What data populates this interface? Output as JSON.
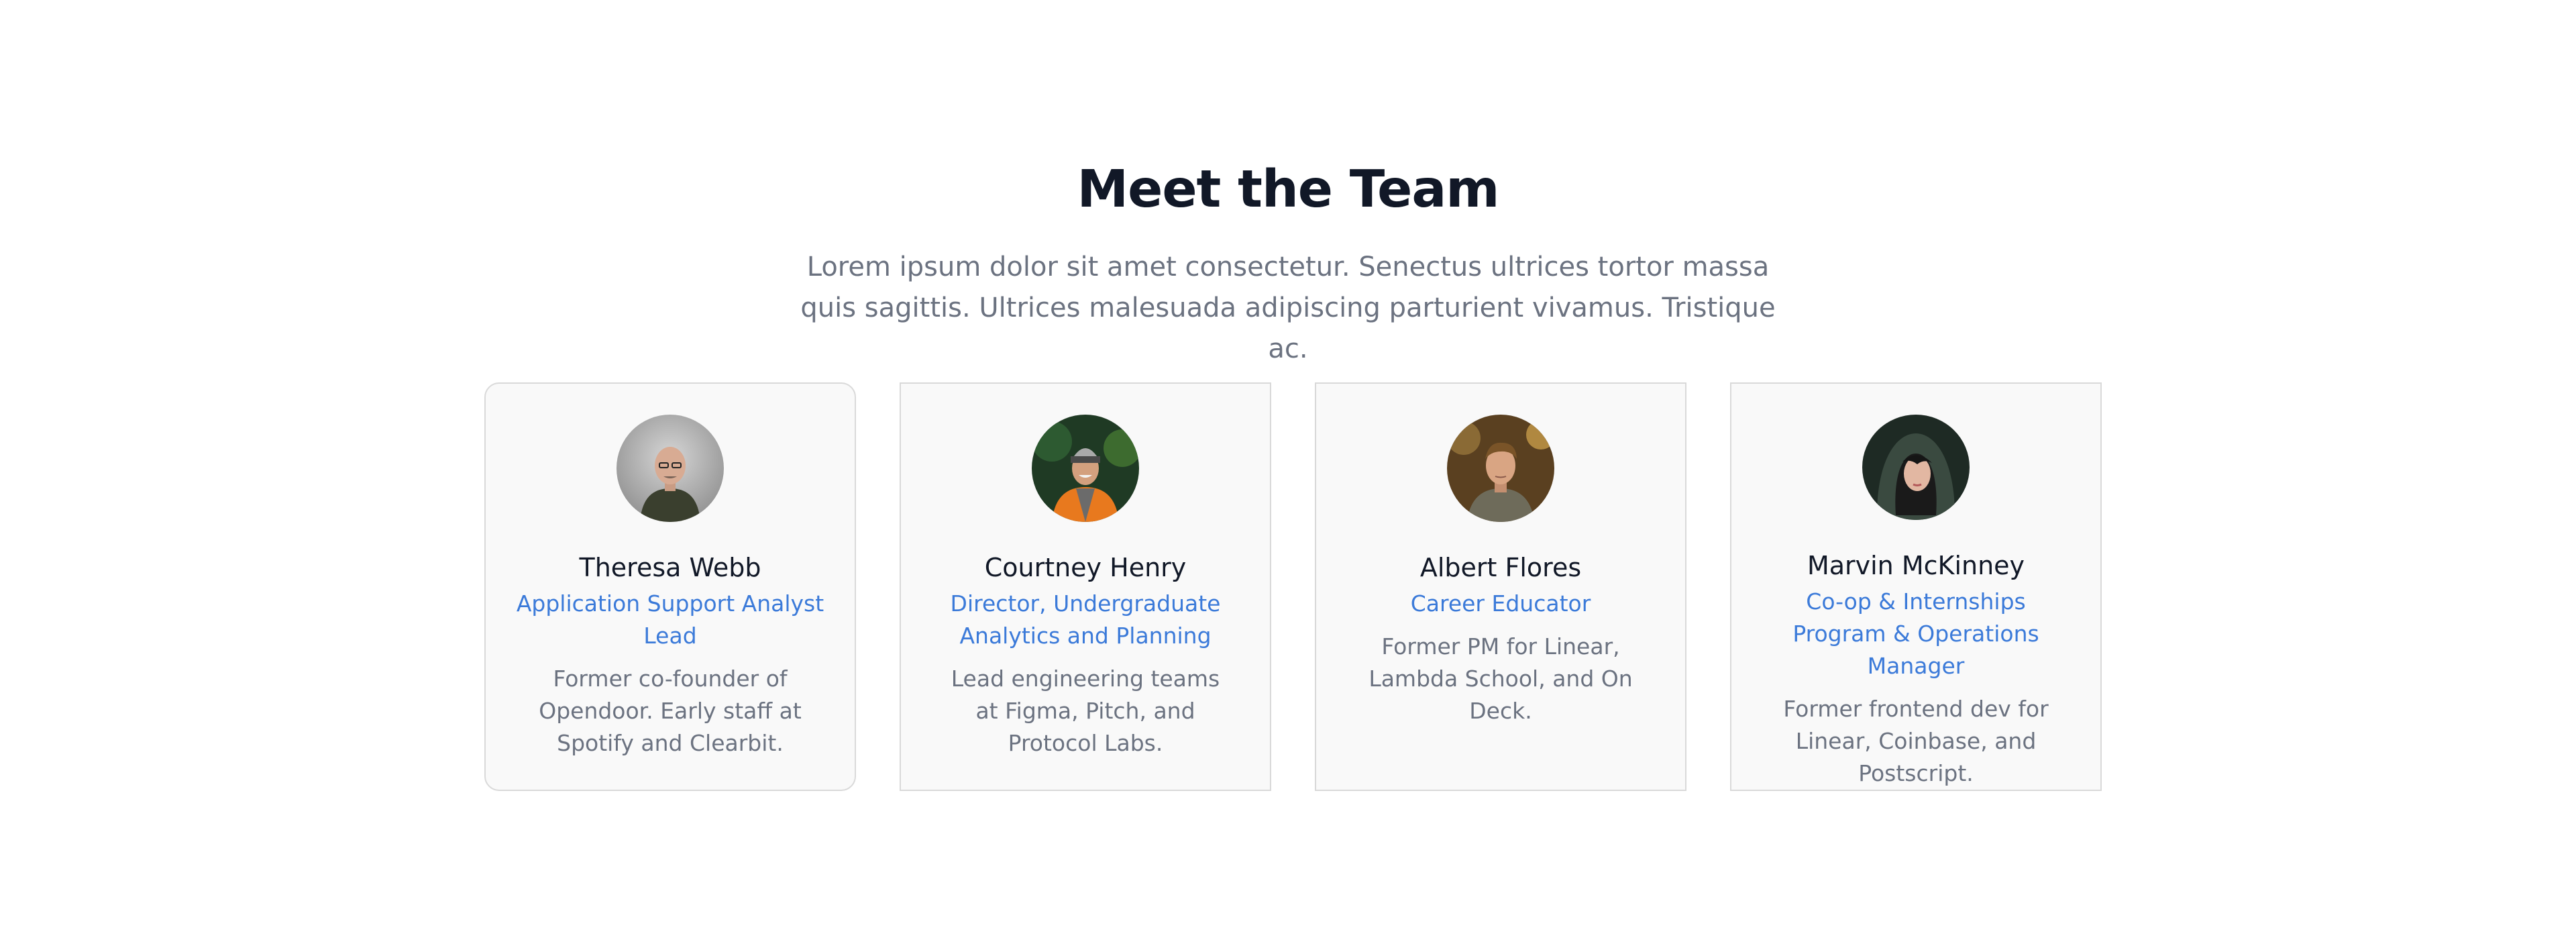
{
  "section": {
    "title": "Meet the Team",
    "subtitle": "Lorem ipsum dolor sit amet consectetur. Senectus ultrices tortor massa quis sagittis. Ultrices malesuada adipiscing parturient vivamus. Tristique ac."
  },
  "members": [
    {
      "name": "Theresa Webb",
      "role": "Application Support Analyst Lead",
      "bio": "Former co-founder of Opendoor. Early staff at Spotify and Clearbit.",
      "avatar": "person-photo-bald-man-glasses"
    },
    {
      "name": "Courtney Henry",
      "role": "Director, Undergraduate Analytics and Planning",
      "bio": "Lead engineering teams at Figma, Pitch, and Protocol Labs.",
      "avatar": "person-photo-man-beanie-orange-jacket"
    },
    {
      "name": "Albert Flores",
      "role": "Career Educator",
      "bio": "Former PM for Linear, Lambda School, and On Deck.",
      "avatar": "person-photo-young-man"
    },
    {
      "name": "Marvin McKinney",
      "role": "Co-op & Internships Program & Operations Manager",
      "bio": "Former frontend dev for Linear, Coinbase, and Postscript.",
      "avatar": "person-photo-woman-hood"
    }
  ],
  "colors": {
    "heading": "#111827",
    "body_text": "#6b7280",
    "role_accent": "#3b7ad9",
    "card_background": "#f9f9f9",
    "card_border": "#d9d9d9"
  }
}
